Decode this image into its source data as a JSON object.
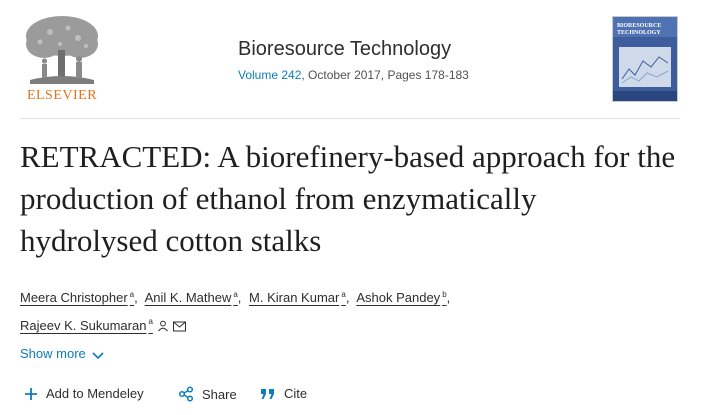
{
  "header": {
    "publisher_logo_text": "ELSEVIER",
    "journal_title": "Bioresource Technology",
    "volume_link": "Volume 242",
    "issue_info": ", October 2017, Pages 178-183",
    "cover_title": "BIORESOURCE TECHNOLOGY"
  },
  "article": {
    "title": "RETRACTED: A biorefinery-based approach for the production of ethanol from enzymatically hydrolysed cotton stalks"
  },
  "authors": [
    {
      "name": "Meera Christopher",
      "affil": "a"
    },
    {
      "name": "Anil K. Mathew",
      "affil": "a"
    },
    {
      "name": "M. Kiran Kumar",
      "affil": "a"
    },
    {
      "name": "Ashok Pandey",
      "affil": "b"
    },
    {
      "name": "Rajeev K. Sukumaran",
      "affil": "a"
    }
  ],
  "separator": ",",
  "show_more_label": "Show more",
  "actions": {
    "mendeley": "Add to Mendeley",
    "share": "Share",
    "cite": "Cite"
  },
  "icons": [
    "elsevier-tree-logo",
    "journal-cover",
    "person-icon",
    "mail-icon",
    "chevron-down-icon",
    "plus-icon",
    "share-icon",
    "quote-icon"
  ],
  "colors": {
    "brand_orange": "#e9711c",
    "link_blue": "#0c7dbb",
    "text": "#1f1f1f"
  }
}
